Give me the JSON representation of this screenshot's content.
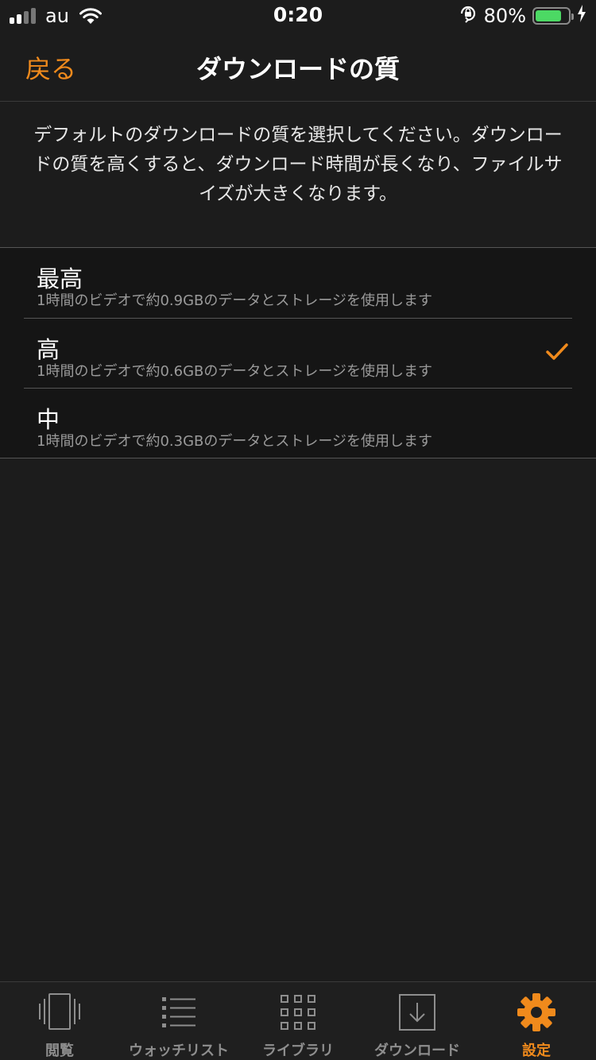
{
  "status_bar": {
    "carrier": "au",
    "time": "0:20",
    "battery_percent": "80%",
    "battery_level": 0.8,
    "icons": [
      "signal-icon",
      "wifi-icon",
      "rotation-lock-icon",
      "battery-icon",
      "charging-icon"
    ]
  },
  "nav": {
    "back_label": "戻る",
    "title": "ダウンロードの質"
  },
  "description": "デフォルトのダウンロードの質を選択してください。ダウンロードの質を高くすると、ダウンロード時間が長くなり、ファイルサイズが大きくなります。",
  "options": [
    {
      "title": "最高",
      "subtitle": "1時間のビデオで約0.9GBのデータとストレージを使用します",
      "selected": false
    },
    {
      "title": "高",
      "subtitle": "1時間のビデオで約0.6GBのデータとストレージを使用します",
      "selected": true
    },
    {
      "title": "中",
      "subtitle": "1時間のビデオで約0.3GBのデータとストレージを使用します",
      "selected": false
    }
  ],
  "tabs": [
    {
      "label": "閲覧",
      "icon": "browse-icon",
      "active": false
    },
    {
      "label": "ウォッチリスト",
      "icon": "list-icon",
      "active": false
    },
    {
      "label": "ライブラリ",
      "icon": "grid-icon",
      "active": false
    },
    {
      "label": "ダウンロード",
      "icon": "download-icon",
      "active": false
    },
    {
      "label": "設定",
      "icon": "gear-icon",
      "active": true
    }
  ],
  "colors": {
    "accent": "#f08a1c",
    "background": "#1c1c1c",
    "battery": "#4cd964"
  }
}
